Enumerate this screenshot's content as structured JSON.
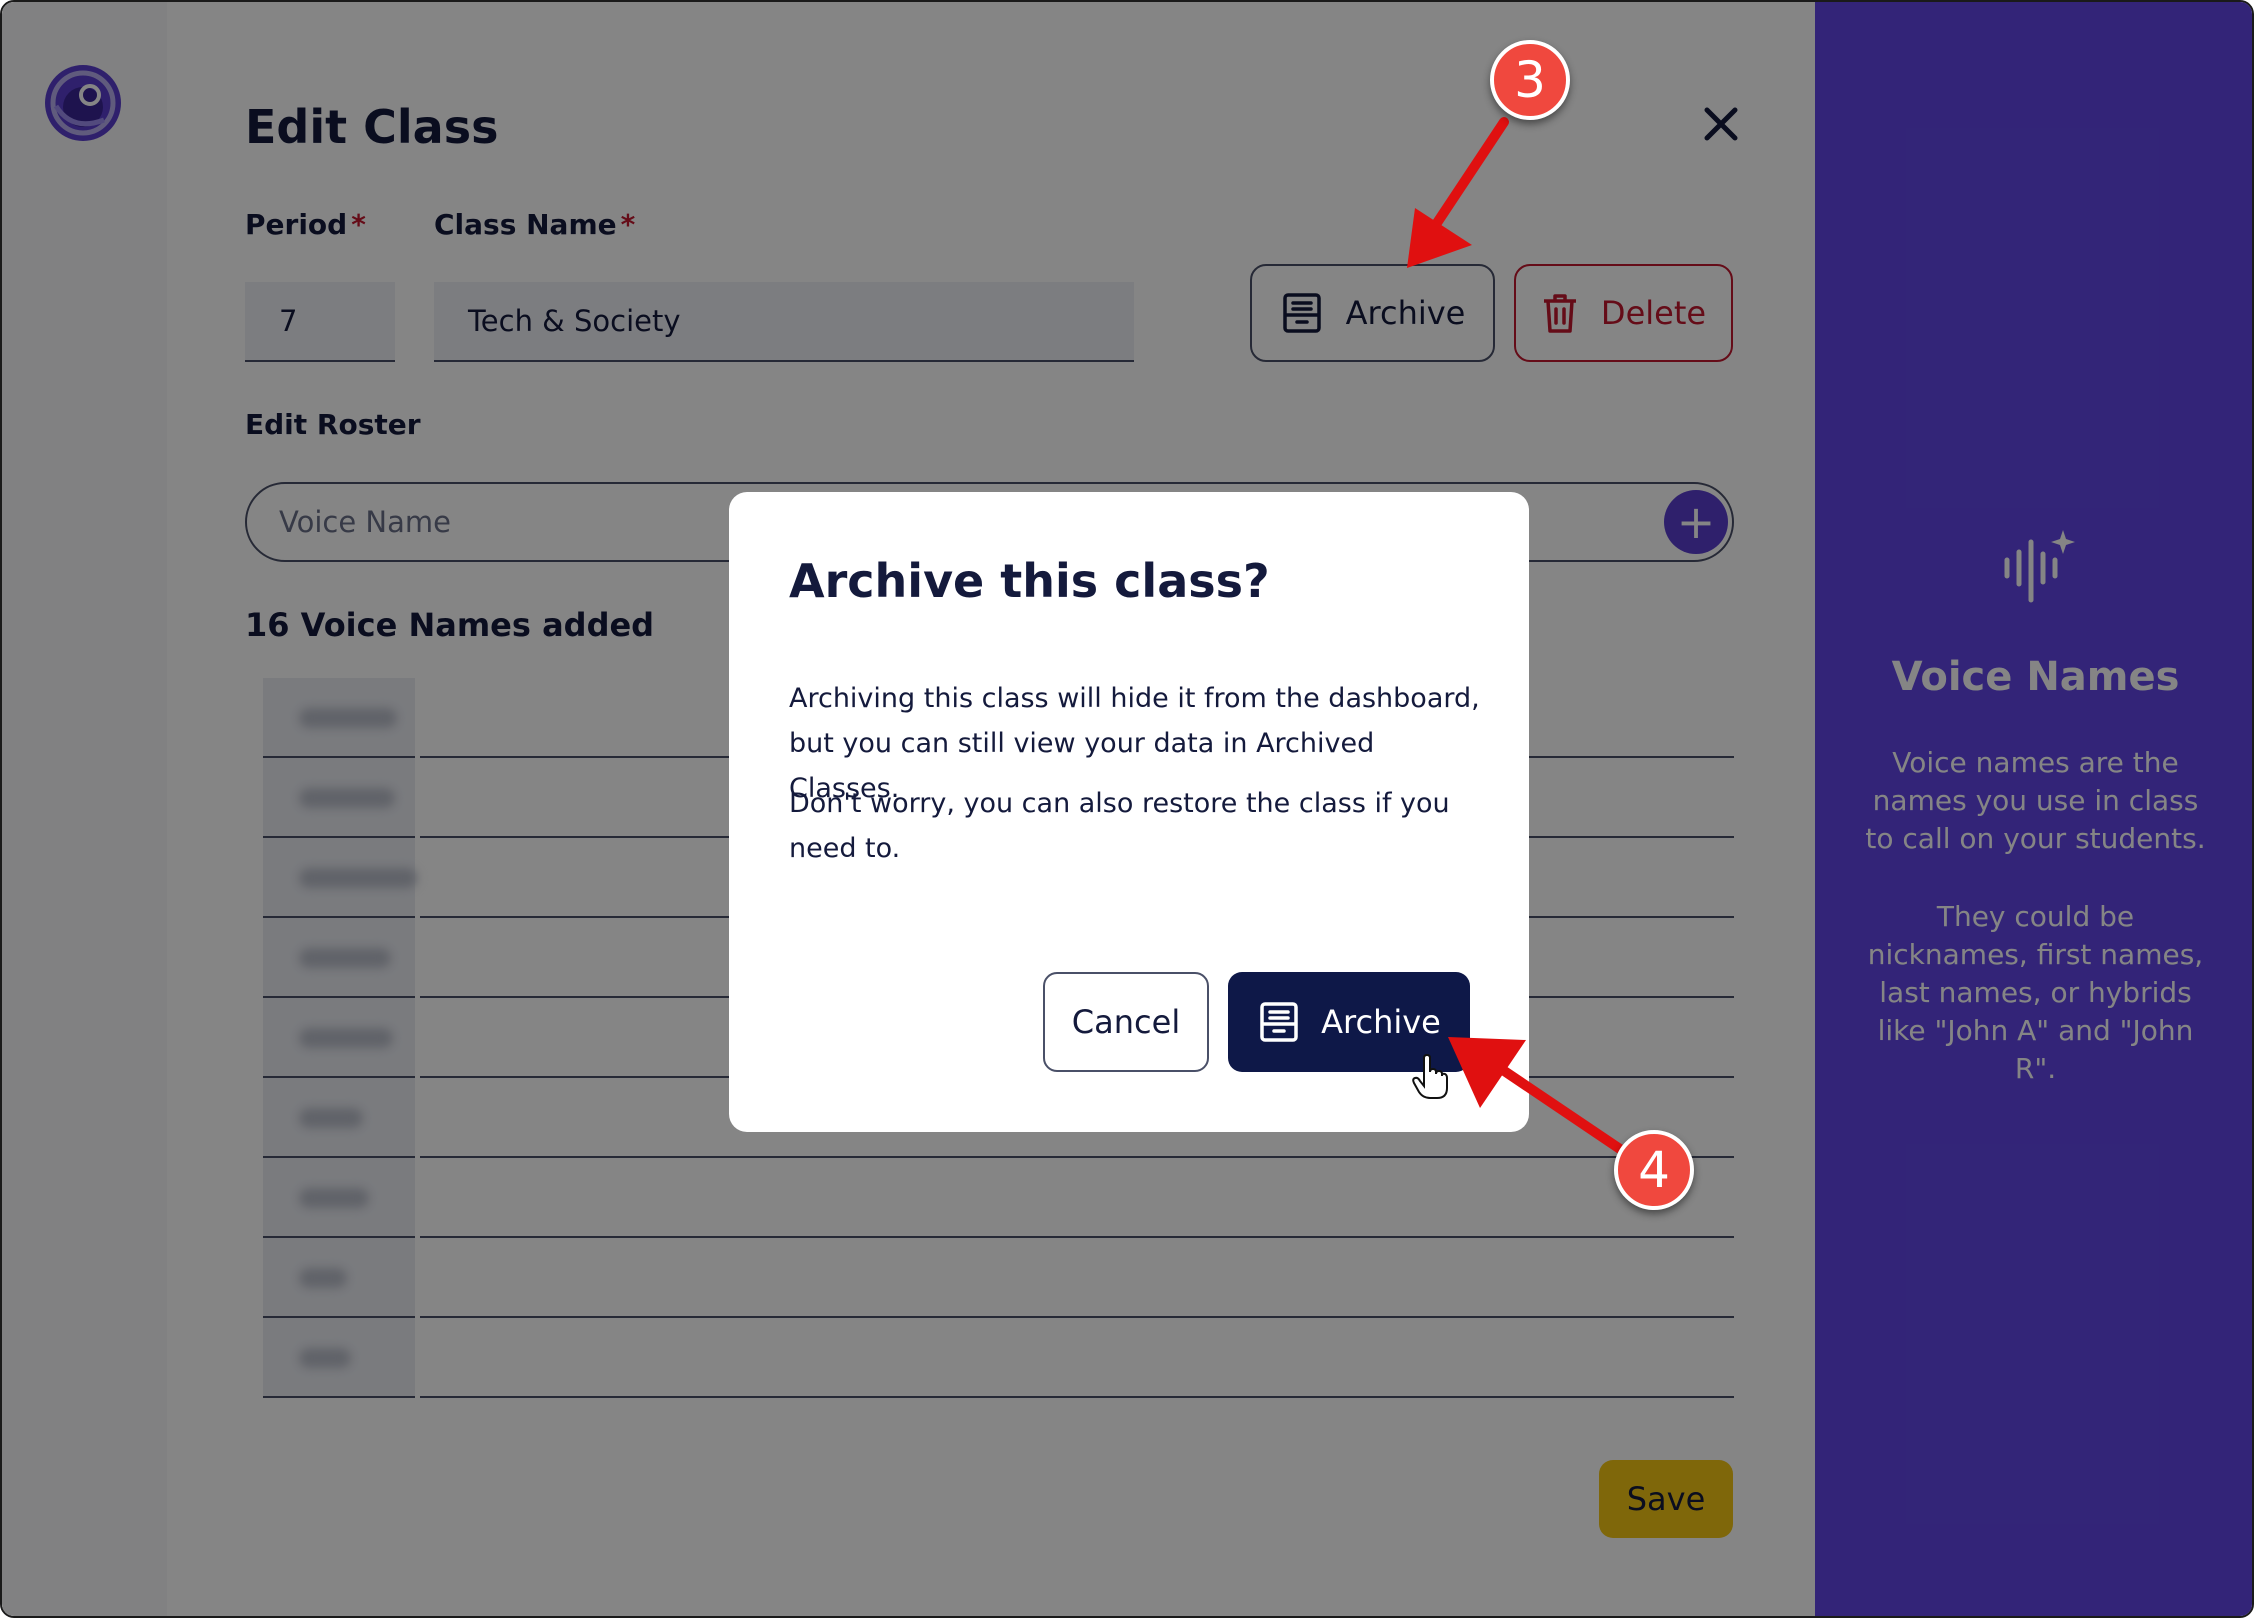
{
  "edit_class": {
    "title": "Edit Class",
    "period_label": "Period",
    "class_name_label": "Class Name",
    "required_mark": "*",
    "period_value": "7",
    "class_name_value": "Tech & Society",
    "archive_label": "Archive",
    "delete_label": "Delete",
    "roster_label": "Edit Roster",
    "voice_name_placeholder": "Voice Name",
    "add_symbol": "+",
    "count_text": "16 Voice Names added",
    "save_label": "Save"
  },
  "side_panel": {
    "title": "Voice Names",
    "paragraph1": "Voice names are the names you use in class to call on your students.",
    "paragraph2": "They could be nicknames, first names, last names, or hybrids like \"John A\" and \"John R\"."
  },
  "modal": {
    "title": "Archive this class?",
    "paragraph1": "Archiving this class will hide it from the dashboard, but you can still view your data in Archived Classes.",
    "paragraph2": "Don't worry, you can also restore the class if you need to.",
    "cancel_label": "Cancel",
    "archive_label": "Archive"
  },
  "annotations": {
    "step3": "3",
    "step4": "4"
  },
  "colors": {
    "accent_purple": "#6246e6",
    "navy": "#141a3c",
    "delete_red": "#c2182f",
    "save_yellow": "#f3c615",
    "annotation_red": "#f0483e"
  },
  "icons": {
    "logo": "logo-icon",
    "close": "close-icon",
    "archive": "archive-box-icon",
    "delete": "trash-icon",
    "add": "plus-icon",
    "voice": "voice-sparkle-icon",
    "cursor": "hand-pointer-icon"
  }
}
